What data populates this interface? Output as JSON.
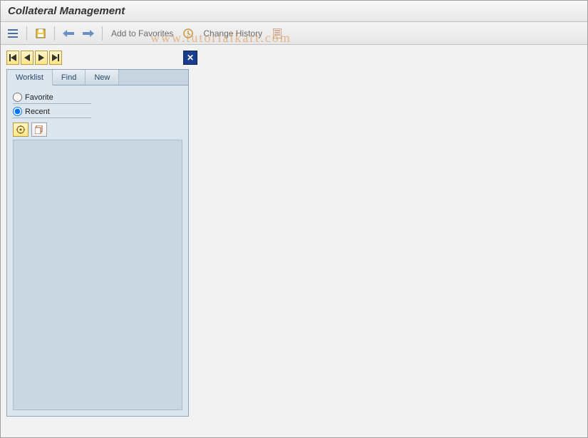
{
  "header": {
    "title": "Collateral Management"
  },
  "toolbar": {
    "add_to_favorites": "Add to Favorites",
    "change_history": "Change History"
  },
  "nav": {
    "first": "|◀",
    "prev": "◀",
    "next": "▶",
    "last": "▶|",
    "close": "✕"
  },
  "panel": {
    "tabs": [
      {
        "id": "worklist",
        "label": "Worklist",
        "active": true
      },
      {
        "id": "find",
        "label": "Find",
        "active": false
      },
      {
        "id": "new",
        "label": "New",
        "active": false
      }
    ],
    "radios": {
      "favorite": "Favorite",
      "recent": "Recent",
      "selected": "recent"
    }
  },
  "watermark": "www.tutorialkart.com"
}
